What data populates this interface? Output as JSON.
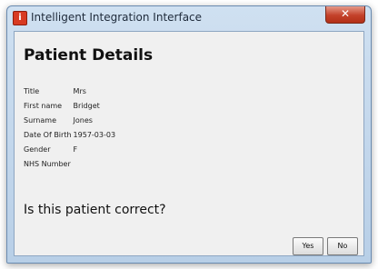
{
  "window": {
    "title": "Intelligent Integration Interface",
    "app_icon_glyph": "i",
    "close_glyph": "✕"
  },
  "page": {
    "heading": "Patient Details",
    "question": "Is this patient correct?"
  },
  "fields": [
    {
      "label": "Title",
      "value": "Mrs"
    },
    {
      "label": "First name",
      "value": "Bridget"
    },
    {
      "label": "Surname",
      "value": "Jones"
    },
    {
      "label": "Date Of Birth",
      "value": "1957-03-03"
    },
    {
      "label": "Gender",
      "value": "F"
    },
    {
      "label": "NHS Number",
      "value": ""
    }
  ],
  "buttons": {
    "yes": "Yes",
    "no": "No"
  },
  "colors": {
    "close_button": "#c3412a",
    "app_icon": "#d83a22",
    "window_frame": "#b8cfe7",
    "content_bg": "#f0f0f0"
  }
}
